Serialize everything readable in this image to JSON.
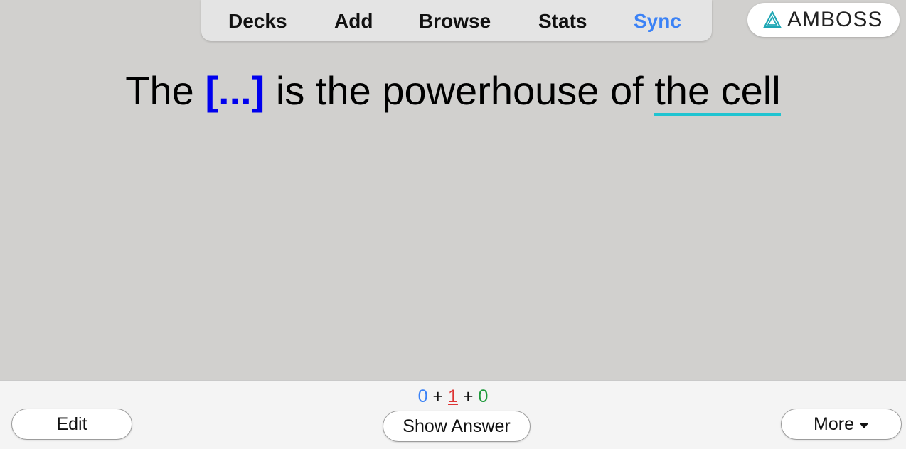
{
  "nav": {
    "items": [
      "Decks",
      "Add",
      "Browse",
      "Stats",
      "Sync"
    ],
    "active_color": "#3b82f6"
  },
  "brand": {
    "name": "AMBOSS",
    "icon": "amboss-triangle-icon",
    "color": "#1fa7b5"
  },
  "card": {
    "prefix": "The",
    "cloze": "[...]",
    "middle": "is the powerhouse of",
    "underlined": "the cell",
    "cloze_color": "#0000ee",
    "underline_color": "#1fc4d1"
  },
  "bottom": {
    "counts": {
      "new": "0",
      "learn": "1",
      "review": "0",
      "separator": "+"
    },
    "edit_label": "Edit",
    "show_answer_label": "Show Answer",
    "more_label": "More"
  }
}
